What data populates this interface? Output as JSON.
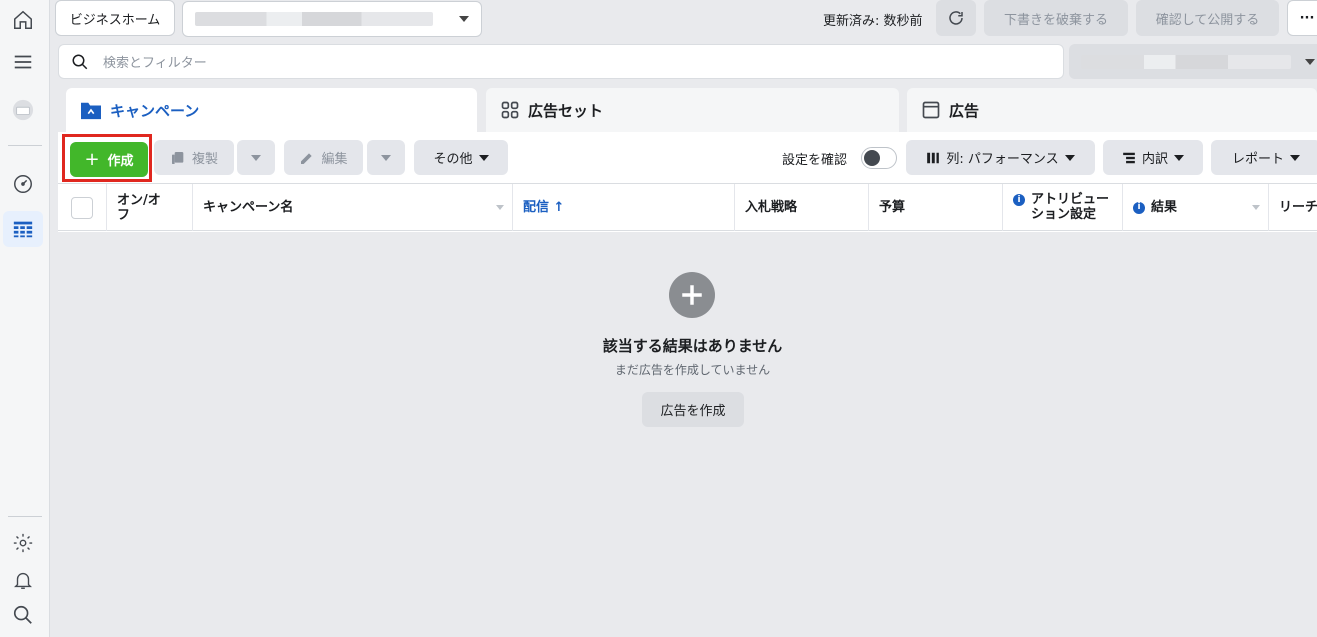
{
  "topbar": {
    "business_home": "ビジネスホーム",
    "updated": "更新済み: 数秒前",
    "discard": "下書きを破棄する",
    "publish": "確認して公開する",
    "more": "···"
  },
  "search": {
    "placeholder": "検索とフィルター"
  },
  "tabs": [
    {
      "label": "キャンペーン",
      "active": true
    },
    {
      "label": "広告セット",
      "active": false
    },
    {
      "label": "広告",
      "active": false
    }
  ],
  "toolbar": {
    "create": "作成",
    "duplicate": "複製",
    "edit": "編集",
    "other": "その他",
    "review_settings": "設定を確認",
    "columns": "列: パフォーマンス",
    "breakdown": "内訳",
    "report": "レポート"
  },
  "table": {
    "headers": {
      "onoff": "オン/オフ",
      "name": "キャンペーン名",
      "delivery": "配信 ↑",
      "bid": "入札戦略",
      "budget": "予算",
      "attribution": "アトリビュー ション設定",
      "results": "結果",
      "reach": "リーチ"
    }
  },
  "empty": {
    "title": "該当する結果はありません",
    "subtitle": "まだ広告を作成していません",
    "button": "広告を作成"
  },
  "colors": {
    "accent": "#1b5fc1",
    "create": "#42b72a",
    "highlight": "#e0271f"
  }
}
